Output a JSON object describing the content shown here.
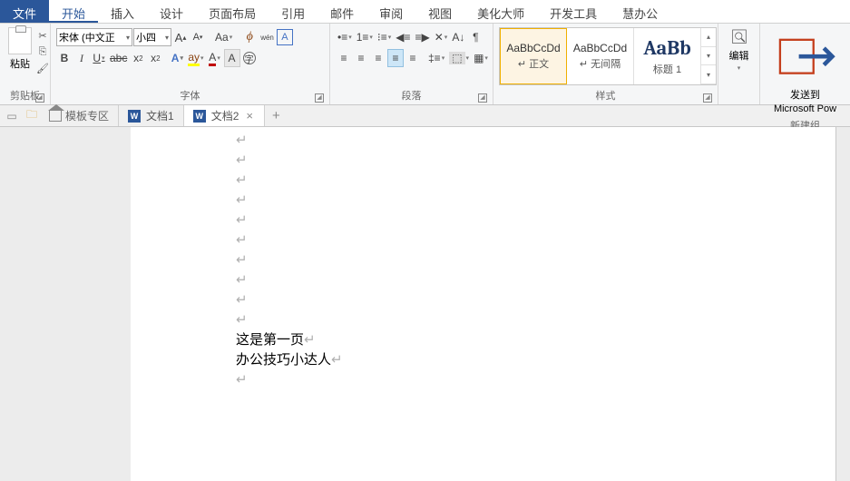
{
  "menubar": {
    "file": "文件",
    "items": [
      "开始",
      "插入",
      "设计",
      "页面布局",
      "引用",
      "邮件",
      "审阅",
      "视图",
      "美化大师",
      "开发工具",
      "慧办公"
    ]
  },
  "clipboard": {
    "paste": "粘贴",
    "label": "剪贴板"
  },
  "font": {
    "name": "宋体 (中文正",
    "size": "小四",
    "label": "字体",
    "wen": "wén"
  },
  "paragraph": {
    "label": "段落"
  },
  "styles": {
    "label": "样式",
    "items": [
      {
        "preview": "AaBbCcDd",
        "name": "↵ 正文"
      },
      {
        "preview": "AaBbCcDd",
        "name": "↵ 无间隔"
      },
      {
        "preview": "AaBb",
        "name": "标题 1"
      }
    ]
  },
  "edit": {
    "label": "编辑"
  },
  "send": {
    "label1": "发送到",
    "label2": "Microsoft Pow",
    "group": "新建组"
  },
  "doctabs": {
    "template": "模板专区",
    "tabs": [
      {
        "label": "文档1"
      },
      {
        "label": "文档2"
      }
    ]
  },
  "doc": {
    "line1": "这是第一页",
    "line2": "办公技巧小达人"
  }
}
